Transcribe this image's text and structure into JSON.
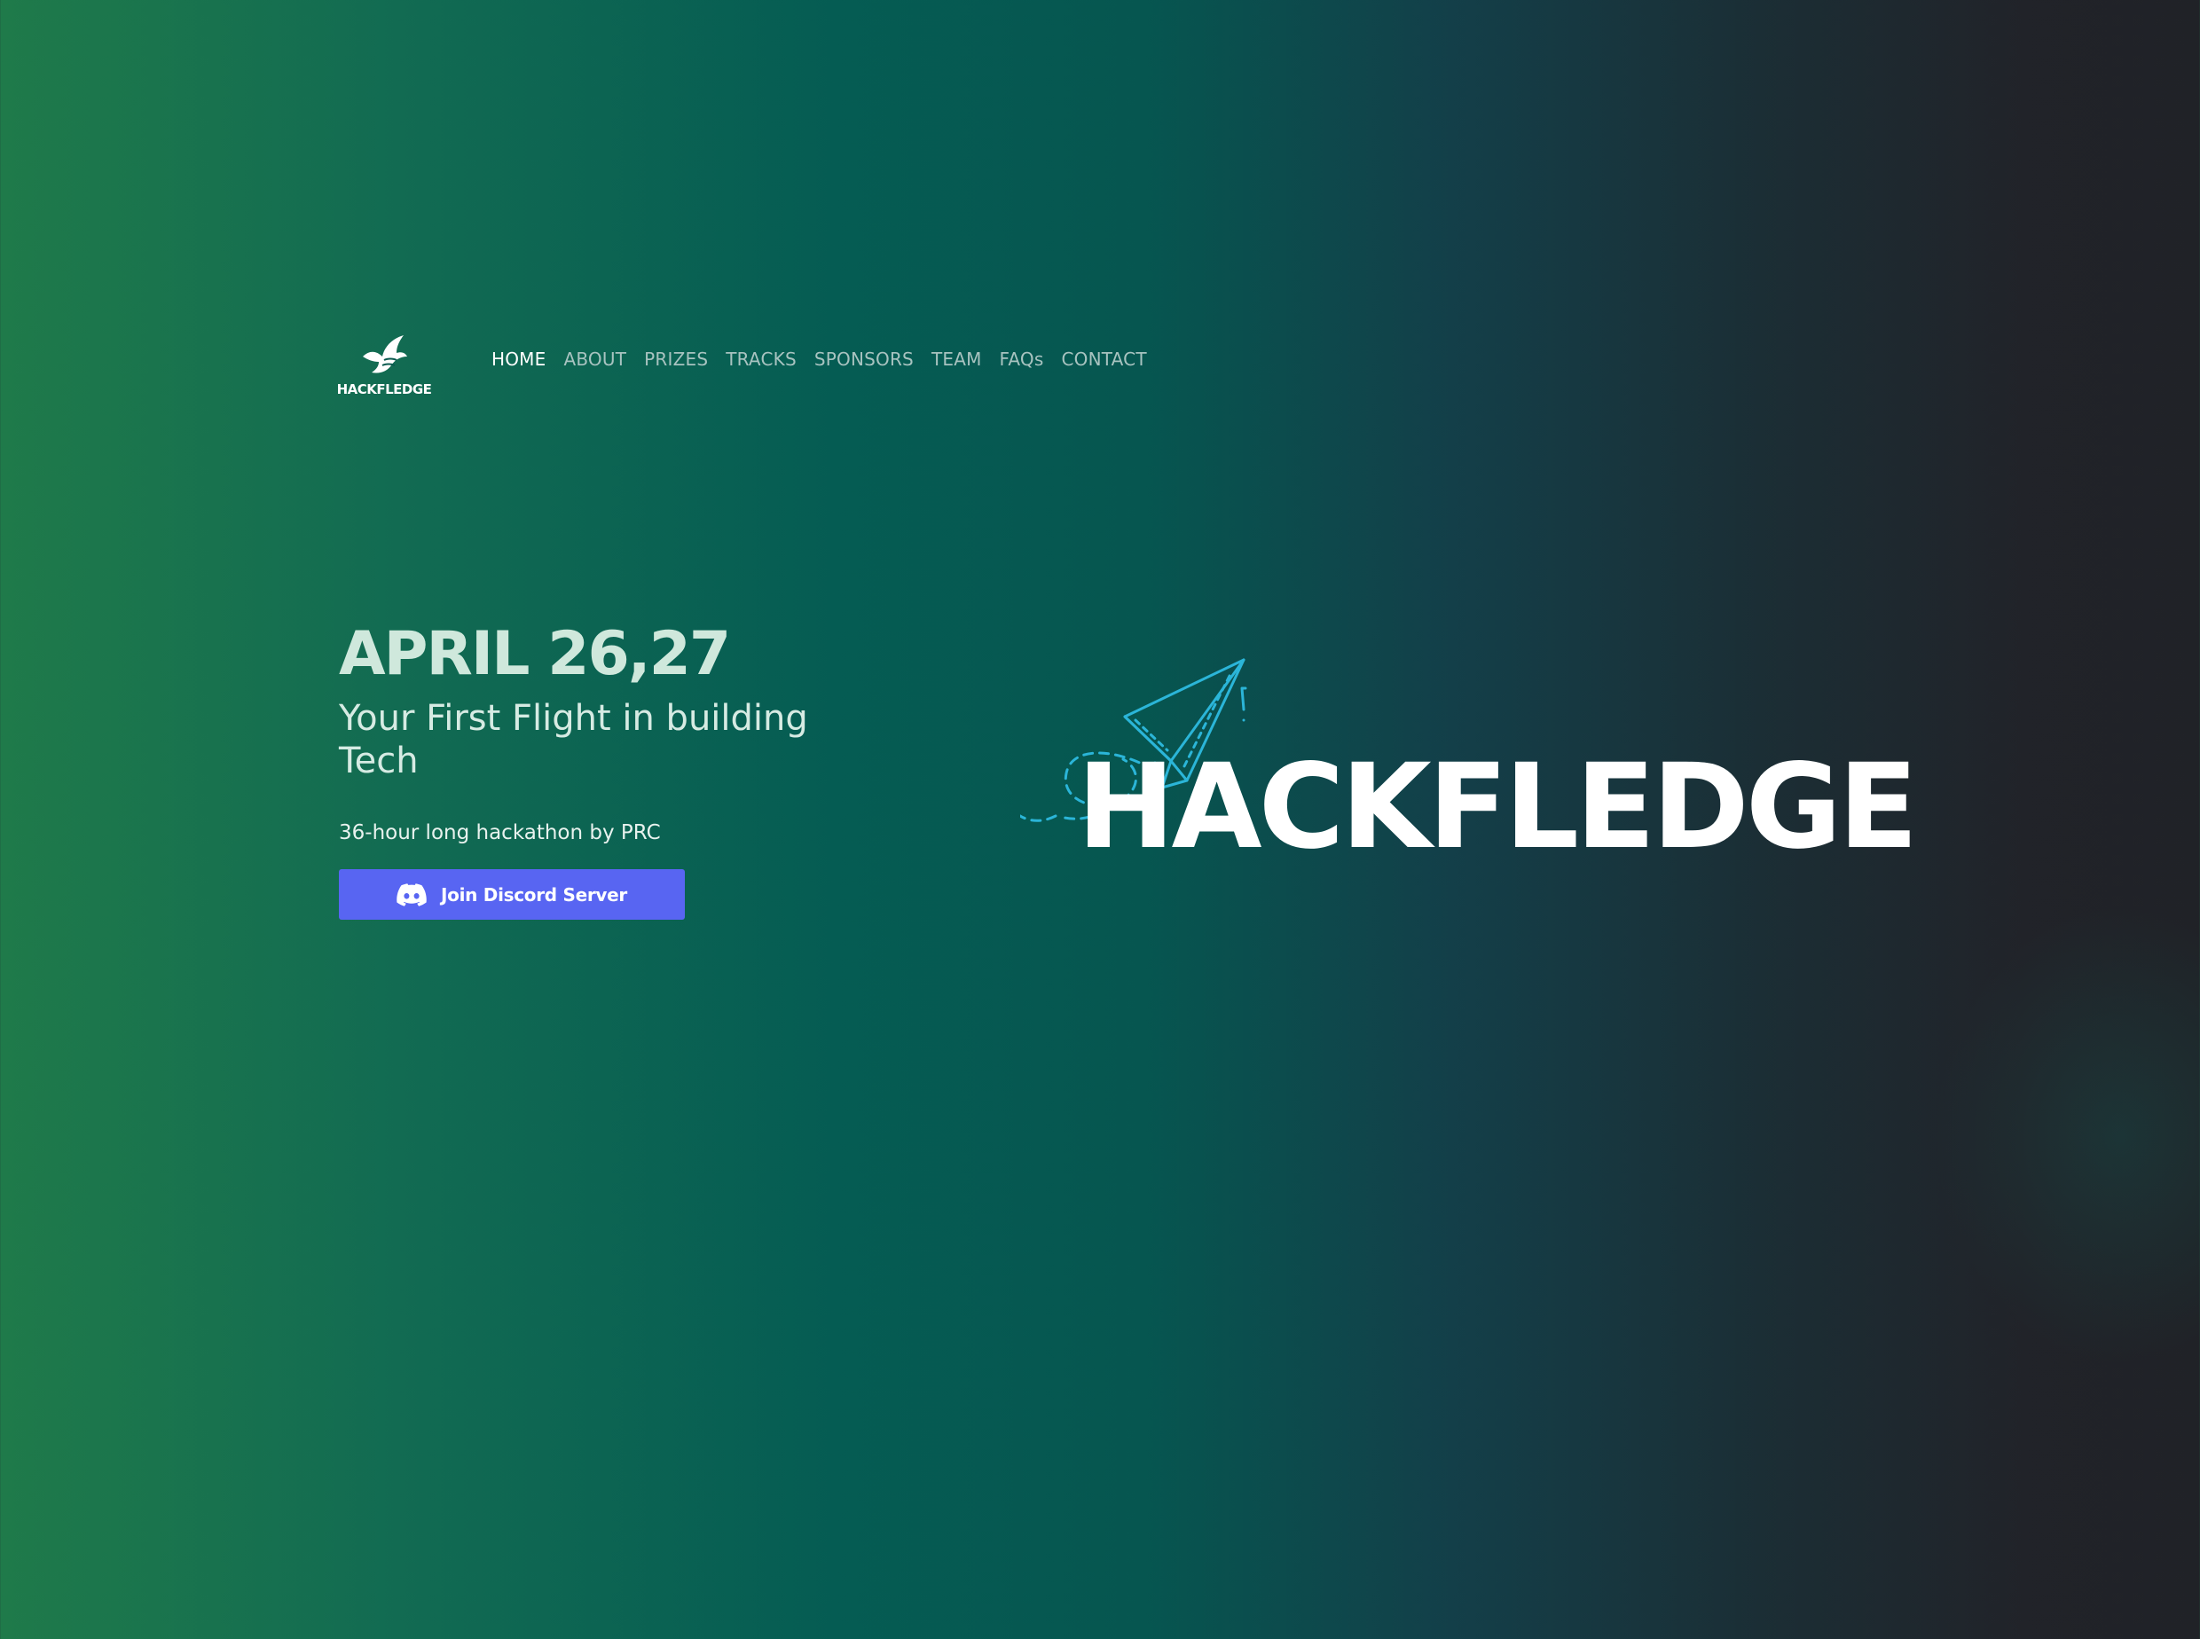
{
  "brand": {
    "logo_text": "HACKFLEDGE",
    "hero_logo_text": "HACKFLEDGE",
    "logo_icon": "bird-icon",
    "hero_icon": "paper-plane-icon"
  },
  "nav": {
    "items": [
      {
        "label": "HOME",
        "active": true
      },
      {
        "label": "ABOUT",
        "active": false
      },
      {
        "label": "PRIZES",
        "active": false
      },
      {
        "label": "TRACKS",
        "active": false
      },
      {
        "label": "SPONSORS",
        "active": false
      },
      {
        "label": "TEAM",
        "active": false
      },
      {
        "label": "FAQs",
        "active": false
      },
      {
        "label": "CONTACT",
        "active": false
      }
    ]
  },
  "hero": {
    "date": "APRIL 26,27",
    "tagline": "Your First Flight in building Tech",
    "subtitle": "36-hour long hackathon by PRC",
    "cta_label": "Join Discord Server",
    "cta_icon": "discord-icon"
  },
  "colors": {
    "bg_left": "#1f7a4a",
    "bg_mid": "#055c53",
    "bg_right": "#202227",
    "accent_button": "#5865f2",
    "plane_stroke": "#2bb5d8",
    "date_text": "#cfe8dc"
  }
}
